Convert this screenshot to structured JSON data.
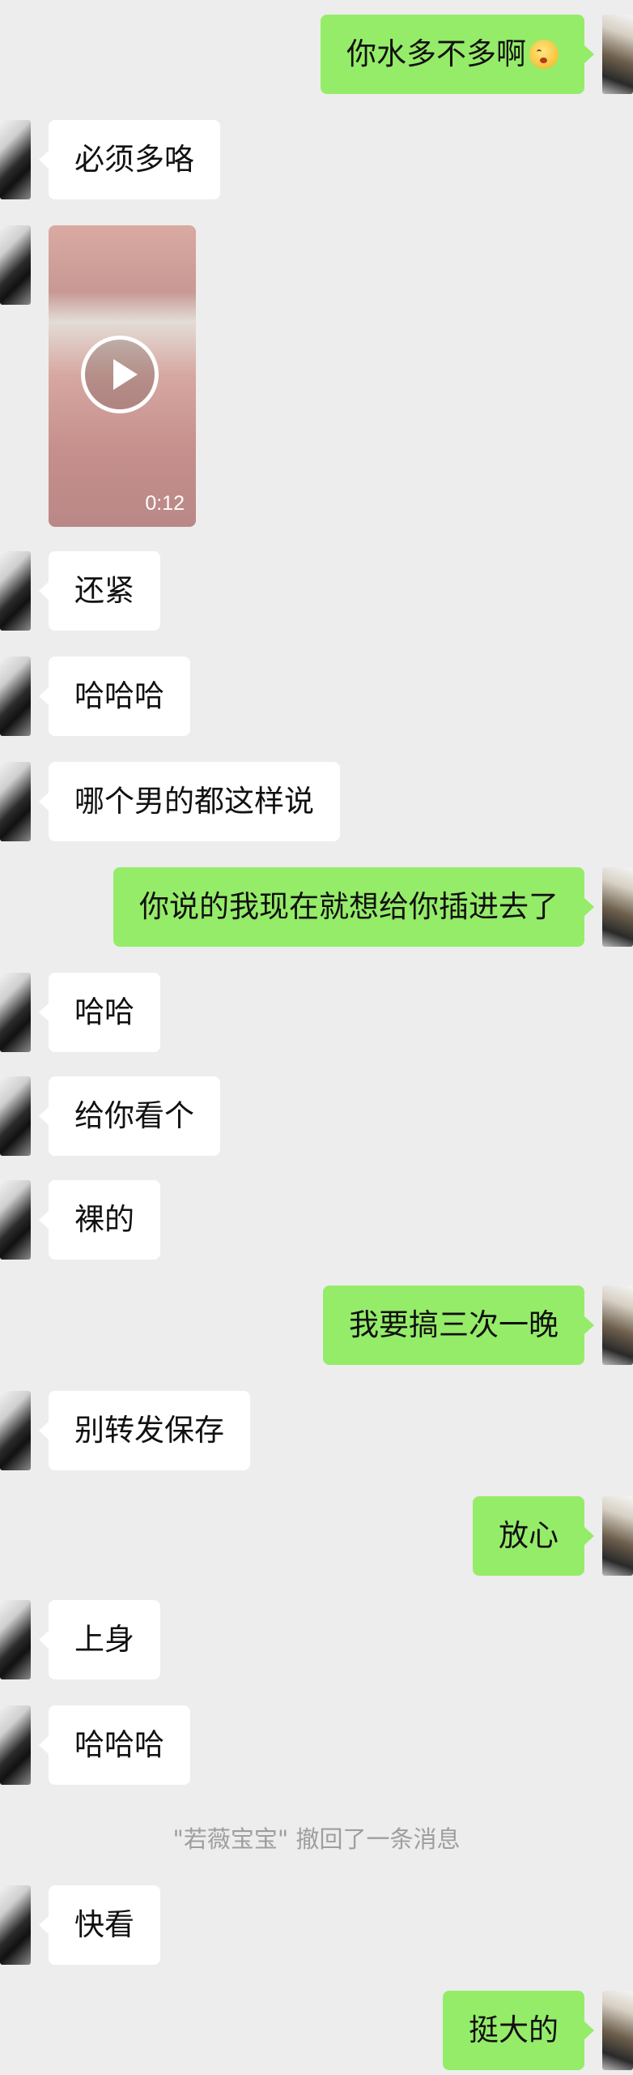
{
  "messages": [
    {
      "text": "你水多不多啊",
      "emoji": "kissing-face-icon"
    },
    {
      "text": "必须多咯"
    },
    {
      "video_duration": "0:12"
    },
    {
      "text": "还紧"
    },
    {
      "text": "哈哈哈"
    },
    {
      "text": "哪个男的都这样说"
    },
    {
      "text": "你说的我现在就想给你插进去了"
    },
    {
      "text": "哈哈"
    },
    {
      "text": "给你看个"
    },
    {
      "text": "裸的"
    },
    {
      "text": "我要搞三次一晚"
    },
    {
      "text": "别转发保存"
    },
    {
      "text": "放心"
    },
    {
      "text": "上身"
    },
    {
      "text": "哈哈哈"
    },
    {
      "system": "\"若薇宝宝\" 撤回了一条消息"
    },
    {
      "text": "快看"
    },
    {
      "text": "挺大的"
    }
  ],
  "colors": {
    "background": "#ededed",
    "incoming_bubble": "#ffffff",
    "outgoing_bubble": "#95ec69"
  }
}
